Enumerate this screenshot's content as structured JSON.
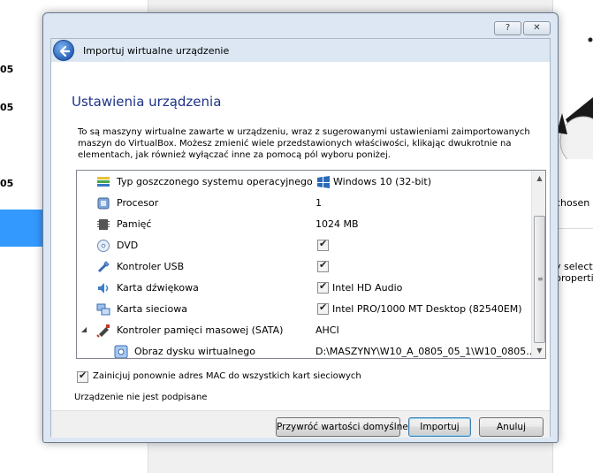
{
  "background": {
    "left_numbers": [
      "05",
      "05",
      "05"
    ],
    "right_texts": [
      "chosen",
      "y selecte",
      "propertie"
    ]
  },
  "dialog": {
    "help_label": "?",
    "close_label": "✕",
    "wizard_title": "Importuj wirtualne urządzenie",
    "section_title": "Ustawienia urządzenia",
    "intro": "To są maszyny wirtualne zawarte w urządzeniu, wraz z sugerowanymi ustawieniami zaimportowanych maszyn do VirtualBox. Możesz zmienić wiele przedstawionych właściwości, klikając dwukrotnie na elementach, jak również wyłączać inne za pomocą pól wyboru poniżej.",
    "rows": [
      {
        "label": "Typ goszczonego systemu operacyjnego",
        "value": "Windows 10 (32-bit)",
        "icon": "os-type-icon"
      },
      {
        "label": "Procesor",
        "value": "1",
        "icon": "cpu-icon"
      },
      {
        "label": "Pamięć",
        "value": "1024 MB",
        "icon": "ram-icon"
      },
      {
        "label": "DVD",
        "value": "",
        "icon": "dvd-icon",
        "checked": true
      },
      {
        "label": "Kontroler USB",
        "value": "",
        "icon": "usb-icon",
        "checked": true
      },
      {
        "label": "Karta dźwiękowa",
        "value": "Intel HD Audio",
        "icon": "sound-card-icon",
        "checked": true
      },
      {
        "label": "Karta sieciowa",
        "value": "Intel PRO/1000 MT Desktop (82540EM)",
        "icon": "network-card-icon",
        "checked": true
      },
      {
        "label": "Kontroler pamięci masowej (SATA)",
        "value": "AHCI",
        "icon": "sata-controller-icon",
        "expander": "◢"
      },
      {
        "label": "Obraz dysku wirtualnego",
        "value": "D:\\MASZYNY\\W10_A_0805_05_1\\W10_0805...",
        "icon": "virtual-disk-icon"
      }
    ],
    "mac_label": "Zainicjuj ponownie adres MAC do wszystkich kart sieciowych",
    "mac_checked": true,
    "unsigned_text": "Urządzenie nie jest podpisane",
    "buttons": {
      "restore": "Przywróć wartości domyślne",
      "import": "Importuj",
      "cancel": "Anuluj"
    },
    "scroll": {
      "up": "▲",
      "down": "▼",
      "grip": "≡"
    },
    "check_mark": "✔"
  },
  "colors": {
    "section_title": "#1e3287",
    "dialog_frame": "#dce7f3",
    "selection": "#3399ff"
  }
}
